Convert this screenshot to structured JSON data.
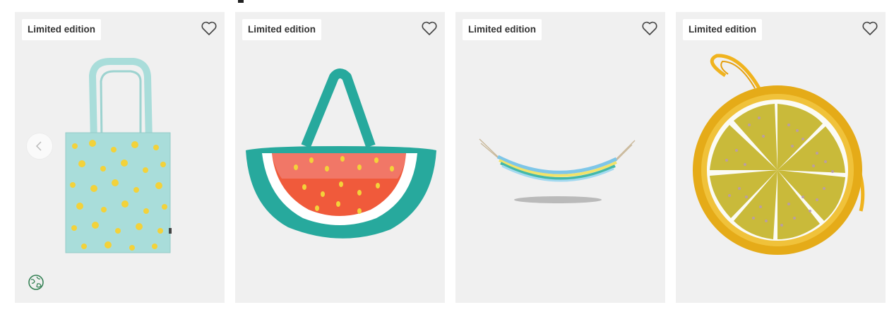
{
  "products": [
    {
      "badge": "Limited edition",
      "name": "pineapple-tote-bag",
      "colors": {
        "main": "#a9ddda",
        "accent": "#f3d23a"
      }
    },
    {
      "badge": "Limited edition",
      "name": "watermelon-bag",
      "colors": {
        "main": "#27a99d",
        "accent": "#f05a3b"
      }
    },
    {
      "badge": "Limited edition",
      "name": "striped-hammock",
      "colors": {
        "main": "#7ec6e8",
        "accent": "#f2e36a"
      }
    },
    {
      "badge": "Limited edition",
      "name": "lemon-coin-purse",
      "colors": {
        "main": "#e5ab18",
        "accent": "#c9ba3a"
      }
    }
  ],
  "icons": {
    "favorite": "heart-outline-icon",
    "carousel_prev": "chevron-left-icon",
    "eco": "globe-leaf-icon"
  }
}
